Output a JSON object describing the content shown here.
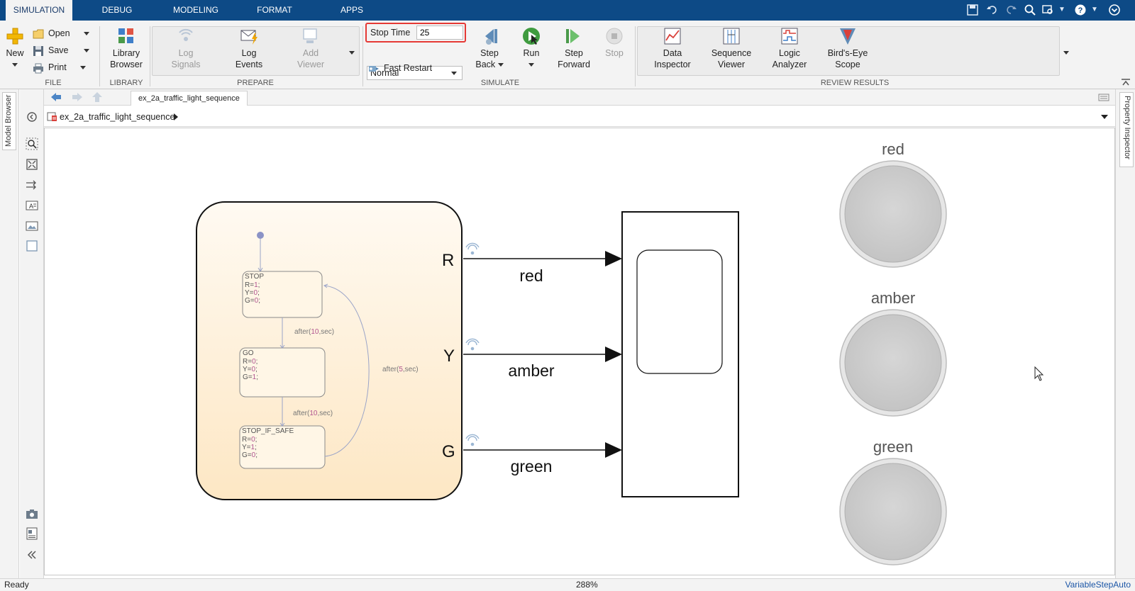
{
  "tabs": [
    {
      "label": "SIMULATION",
      "active": true
    },
    {
      "label": "DEBUG"
    },
    {
      "label": "MODELING"
    },
    {
      "label": "FORMAT"
    },
    {
      "label": "APPS"
    }
  ],
  "quick_access_icons": [
    "save-icon",
    "undo-icon",
    "redo-icon",
    "search-icon",
    "find-icon",
    "help-icon",
    "minimize-ribbon-icon"
  ],
  "ribbon": {
    "file": {
      "label": "FILE",
      "new": "New",
      "open": "Open",
      "save": "Save",
      "print": "Print"
    },
    "library": {
      "label": "LIBRARY",
      "library_browser_line1": "Library",
      "library_browser_line2": "Browser"
    },
    "prepare": {
      "label": "PREPARE",
      "log_signals_line1": "Log",
      "log_signals_line2": "Signals",
      "log_events_line1": "Log",
      "log_events_line2": "Events",
      "add_viewer_line1": "Add",
      "add_viewer_line2": "Viewer"
    },
    "simulate": {
      "label": "SIMULATE",
      "stop_time_label": "Stop Time",
      "stop_time_value": "25",
      "mode": "Normal",
      "fast_restart": "Fast Restart",
      "step_back_line1": "Step",
      "step_back_line2": "Back",
      "run": "Run",
      "step_forward_line1": "Step",
      "step_forward_line2": "Forward",
      "stop": "Stop"
    },
    "review": {
      "label": "REVIEW RESULTS",
      "data_inspector_line1": "Data",
      "data_inspector_line2": "Inspector",
      "sequence_viewer_line1": "Sequence",
      "sequence_viewer_line2": "Viewer",
      "logic_analyzer_line1": "Logic",
      "logic_analyzer_line2": "Analyzer",
      "birds_eye_line1": "Bird's-Eye",
      "birds_eye_line2": "Scope"
    }
  },
  "side_tabs": {
    "model_browser": "Model Browser",
    "property_inspector": "Property Inspector"
  },
  "model_tab": "ex_2a_traffic_light_sequence",
  "breadcrumb": "ex_2a_traffic_light_sequence",
  "chart": {
    "states": [
      {
        "name": "STOP",
        "lines": [
          "R=",
          "1",
          "Y=",
          "0",
          "G=",
          "0"
        ]
      },
      {
        "name": "GO",
        "lines": [
          "R=",
          "0",
          "Y=",
          "0",
          "G=",
          "1"
        ]
      },
      {
        "name": "STOP_IF_SAFE",
        "lines": [
          "R=",
          "0",
          "Y=",
          "1",
          "G=",
          "0"
        ]
      }
    ],
    "transitions": {
      "t1": {
        "pre": "after(",
        "num": "10",
        "post": ",sec)"
      },
      "t2": {
        "pre": "after(",
        "num": "10",
        "post": ",sec)"
      },
      "t3": {
        "pre": "after(",
        "num": "5",
        "post": ",sec)"
      }
    },
    "outputs": [
      "R",
      "Y",
      "G"
    ],
    "signals": [
      "red",
      "amber",
      "green"
    ]
  },
  "lamps": [
    "red",
    "amber",
    "green"
  ],
  "status": {
    "left": "Ready",
    "zoom": "288%",
    "solver": "VariableStepAuto"
  },
  "colors": {
    "tabbar": "#0d4a86",
    "highlight": "#e53935",
    "chart_fill": "#fdeed3",
    "lamp": "#d3d3d3"
  }
}
